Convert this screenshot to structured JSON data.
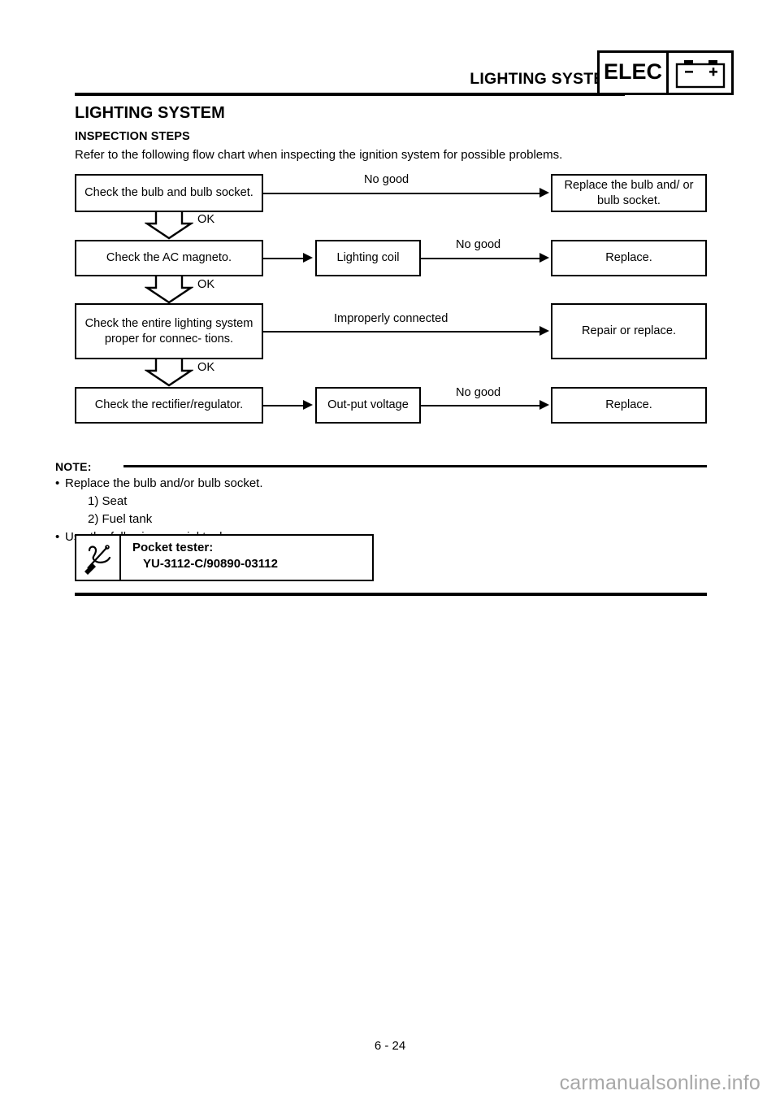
{
  "header": {
    "title": "LIGHTING SYSTEM",
    "badge_label": "ELEC",
    "badge_icon": "battery-icon",
    "battery_negative": "–",
    "battery_positive": "+"
  },
  "document": {
    "section_title": "LIGHTING SYSTEM",
    "subsection_title": "INSPECTION STEPS",
    "intro_text": "Refer to the following flow chart when inspecting the ignition system for possible problems."
  },
  "flowchart": {
    "ok_label": "OK",
    "rows": [
      {
        "check": "Check the bulb and bulb socket.",
        "middle": null,
        "edge_label": "No good",
        "result": "Replace the bulb and/ or bulb socket.",
        "ok_next": true
      },
      {
        "check": "Check the AC magneto.",
        "middle": "Lighting coil",
        "edge_label": "No good",
        "result": "Replace.",
        "ok_next": true
      },
      {
        "check": "Check the entire lighting system proper for connec- tions.",
        "middle": null,
        "edge_label": "Improperly connected",
        "result": "Repair or replace.",
        "ok_next": true
      },
      {
        "check": "Check the rectifier/regulator.",
        "middle": "Out-put voltage",
        "edge_label": "No good",
        "result": "Replace.",
        "ok_next": false
      }
    ]
  },
  "note": {
    "label": "NOTE:",
    "bullet_symbol": "•",
    "lines": [
      "Replace the bulb and/or bulb socket.",
      "1) Seat",
      "2) Fuel tank",
      "Use the following special tool."
    ]
  },
  "tool": {
    "icon": "screwdriver-wrench-icon",
    "name": "Pocket tester:",
    "number": "YU-3112-C/90890-03112"
  },
  "footer": {
    "page_number": "6 - 24",
    "watermark": "carmanualsonline.info"
  },
  "colors": {
    "ink": "#000000",
    "paper": "#ffffff",
    "watermark": "#a8a8a8"
  }
}
